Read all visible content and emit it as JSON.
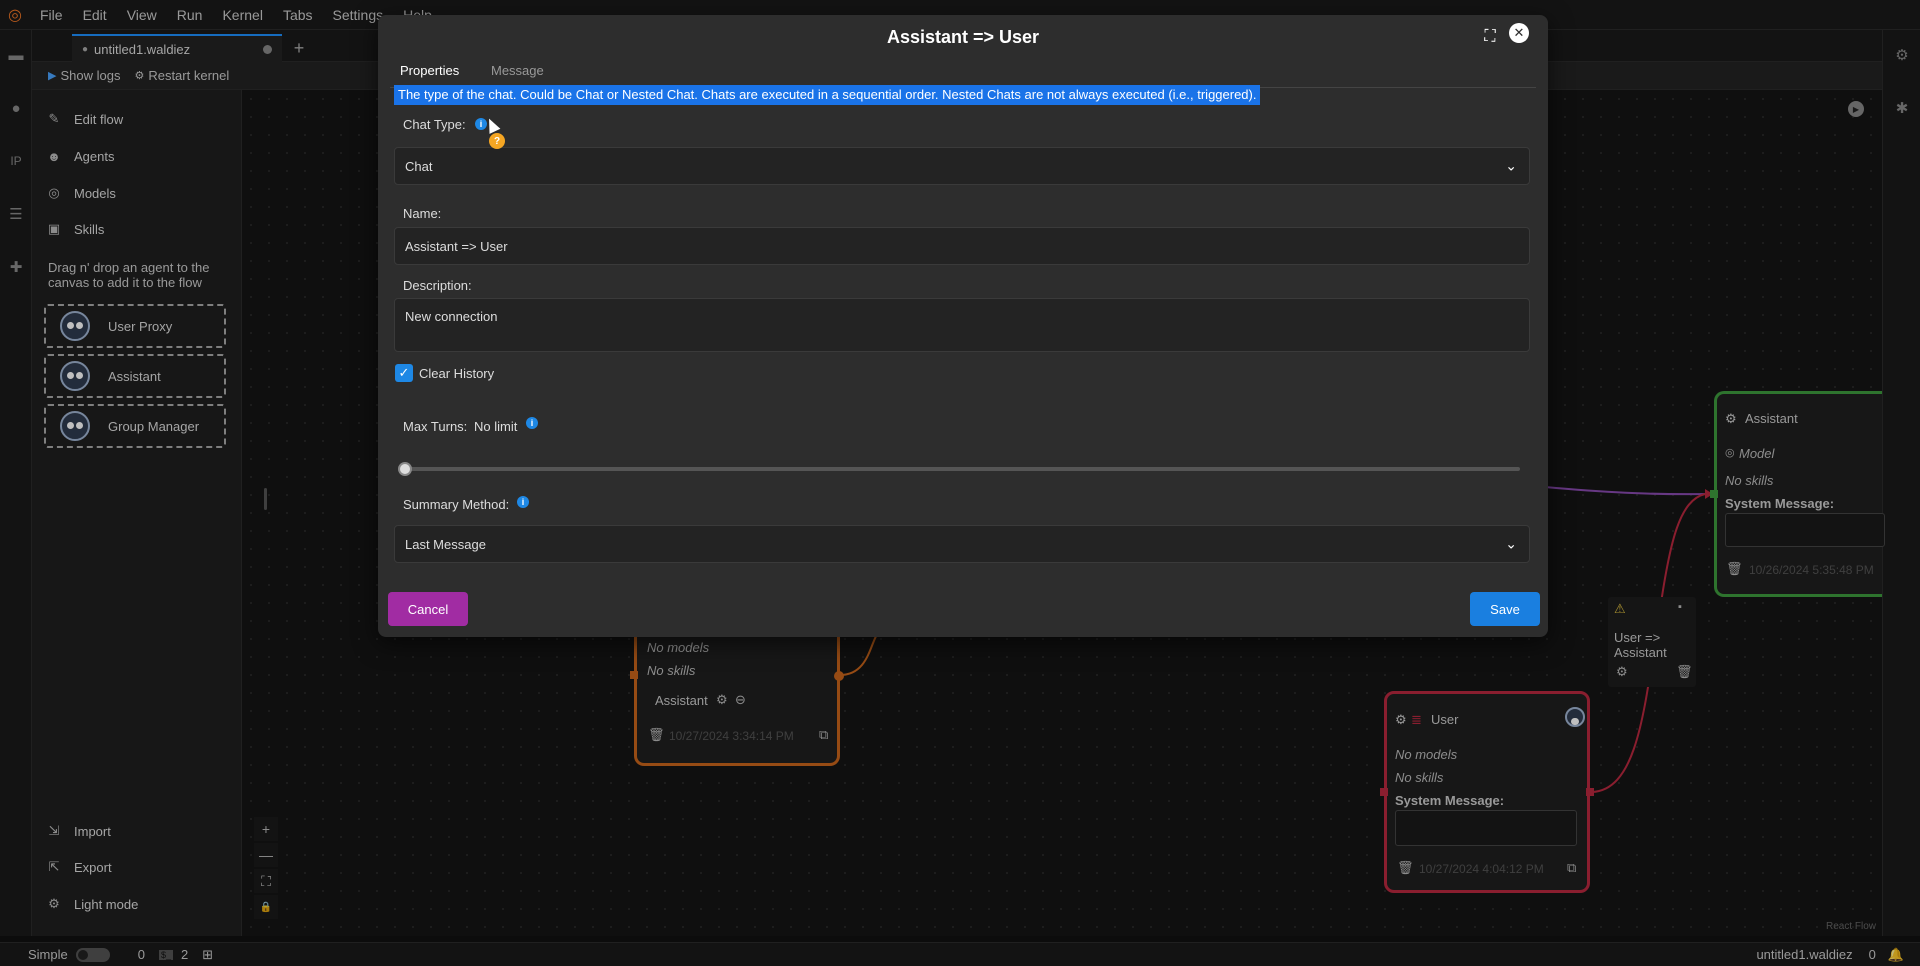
{
  "menu": {
    "items": [
      "File",
      "Edit",
      "View",
      "Run",
      "Kernel",
      "Tabs",
      "Settings",
      "Help"
    ]
  },
  "tab": {
    "name": "untitled1.waldiez",
    "add": "+"
  },
  "toolbar": {
    "show_logs": "Show logs",
    "restart_kernel": "Restart kernel"
  },
  "sidebar": {
    "edit_flow": "Edit flow",
    "agents": "Agents",
    "models": "Models",
    "skills": "Skills",
    "hint": "Drag n' drop an agent to the canvas to add it to the flow",
    "agent_cards": [
      "User Proxy",
      "Assistant",
      "Group Manager"
    ],
    "import": "Import",
    "export": "Export",
    "light_mode": "Light mode"
  },
  "canvas": {
    "center_node": {
      "no_models": "No models",
      "no_skills": "No skills",
      "agent_label": "Assistant",
      "timestamp": "10/27/2024 3:34:14 PM",
      "color": "#c8651b"
    },
    "user_node": {
      "title": "User",
      "no_models": "No models",
      "no_skills": "No skills",
      "system_message": "System Message:",
      "timestamp": "10/27/2024 4:04:12 PM",
      "color": "#b8283f"
    },
    "assistant_node": {
      "title": "Assistant",
      "model": "Model",
      "no_skills": "No skills",
      "system_message": "System Message:",
      "timestamp": "10/26/2024 5:35:48 PM",
      "color": "#3e9b3e"
    },
    "edge_label": "User => Assistant",
    "attribution": "React Flow",
    "zoom_controls": [
      "+",
      "—",
      "⛶",
      "🔒"
    ]
  },
  "statusbar": {
    "mode": "Simple",
    "count1": "0",
    "count2": "2",
    "filename": "untitled1.waldiez",
    "right_count": "0"
  },
  "modal": {
    "title": "Assistant => User",
    "tabs": [
      "Properties",
      "Message"
    ],
    "tooltip": "The type of the chat. Could be Chat or Nested Chat. Chats are executed in a sequential order. Nested Chats are not always executed (i.e., triggered).",
    "chat_type_label": "Chat Type:",
    "chat_type_value": "Chat",
    "name_label": "Name:",
    "name_value": "Assistant => User",
    "description_label": "Description:",
    "description_value": "New connection",
    "clear_history_label": "Clear History",
    "clear_history_checked": true,
    "max_turns_label": "Max Turns:",
    "max_turns_value": "No limit",
    "max_turns_fraction": 0,
    "summary_method_label": "Summary Method:",
    "summary_method_value": "Last Message",
    "cancel": "Cancel",
    "save": "Save"
  },
  "colors": {
    "accent": "#1e88e5",
    "cancel": "#a12ca3",
    "save": "#1a7fe0",
    "tooltip": "#1a73e8"
  }
}
